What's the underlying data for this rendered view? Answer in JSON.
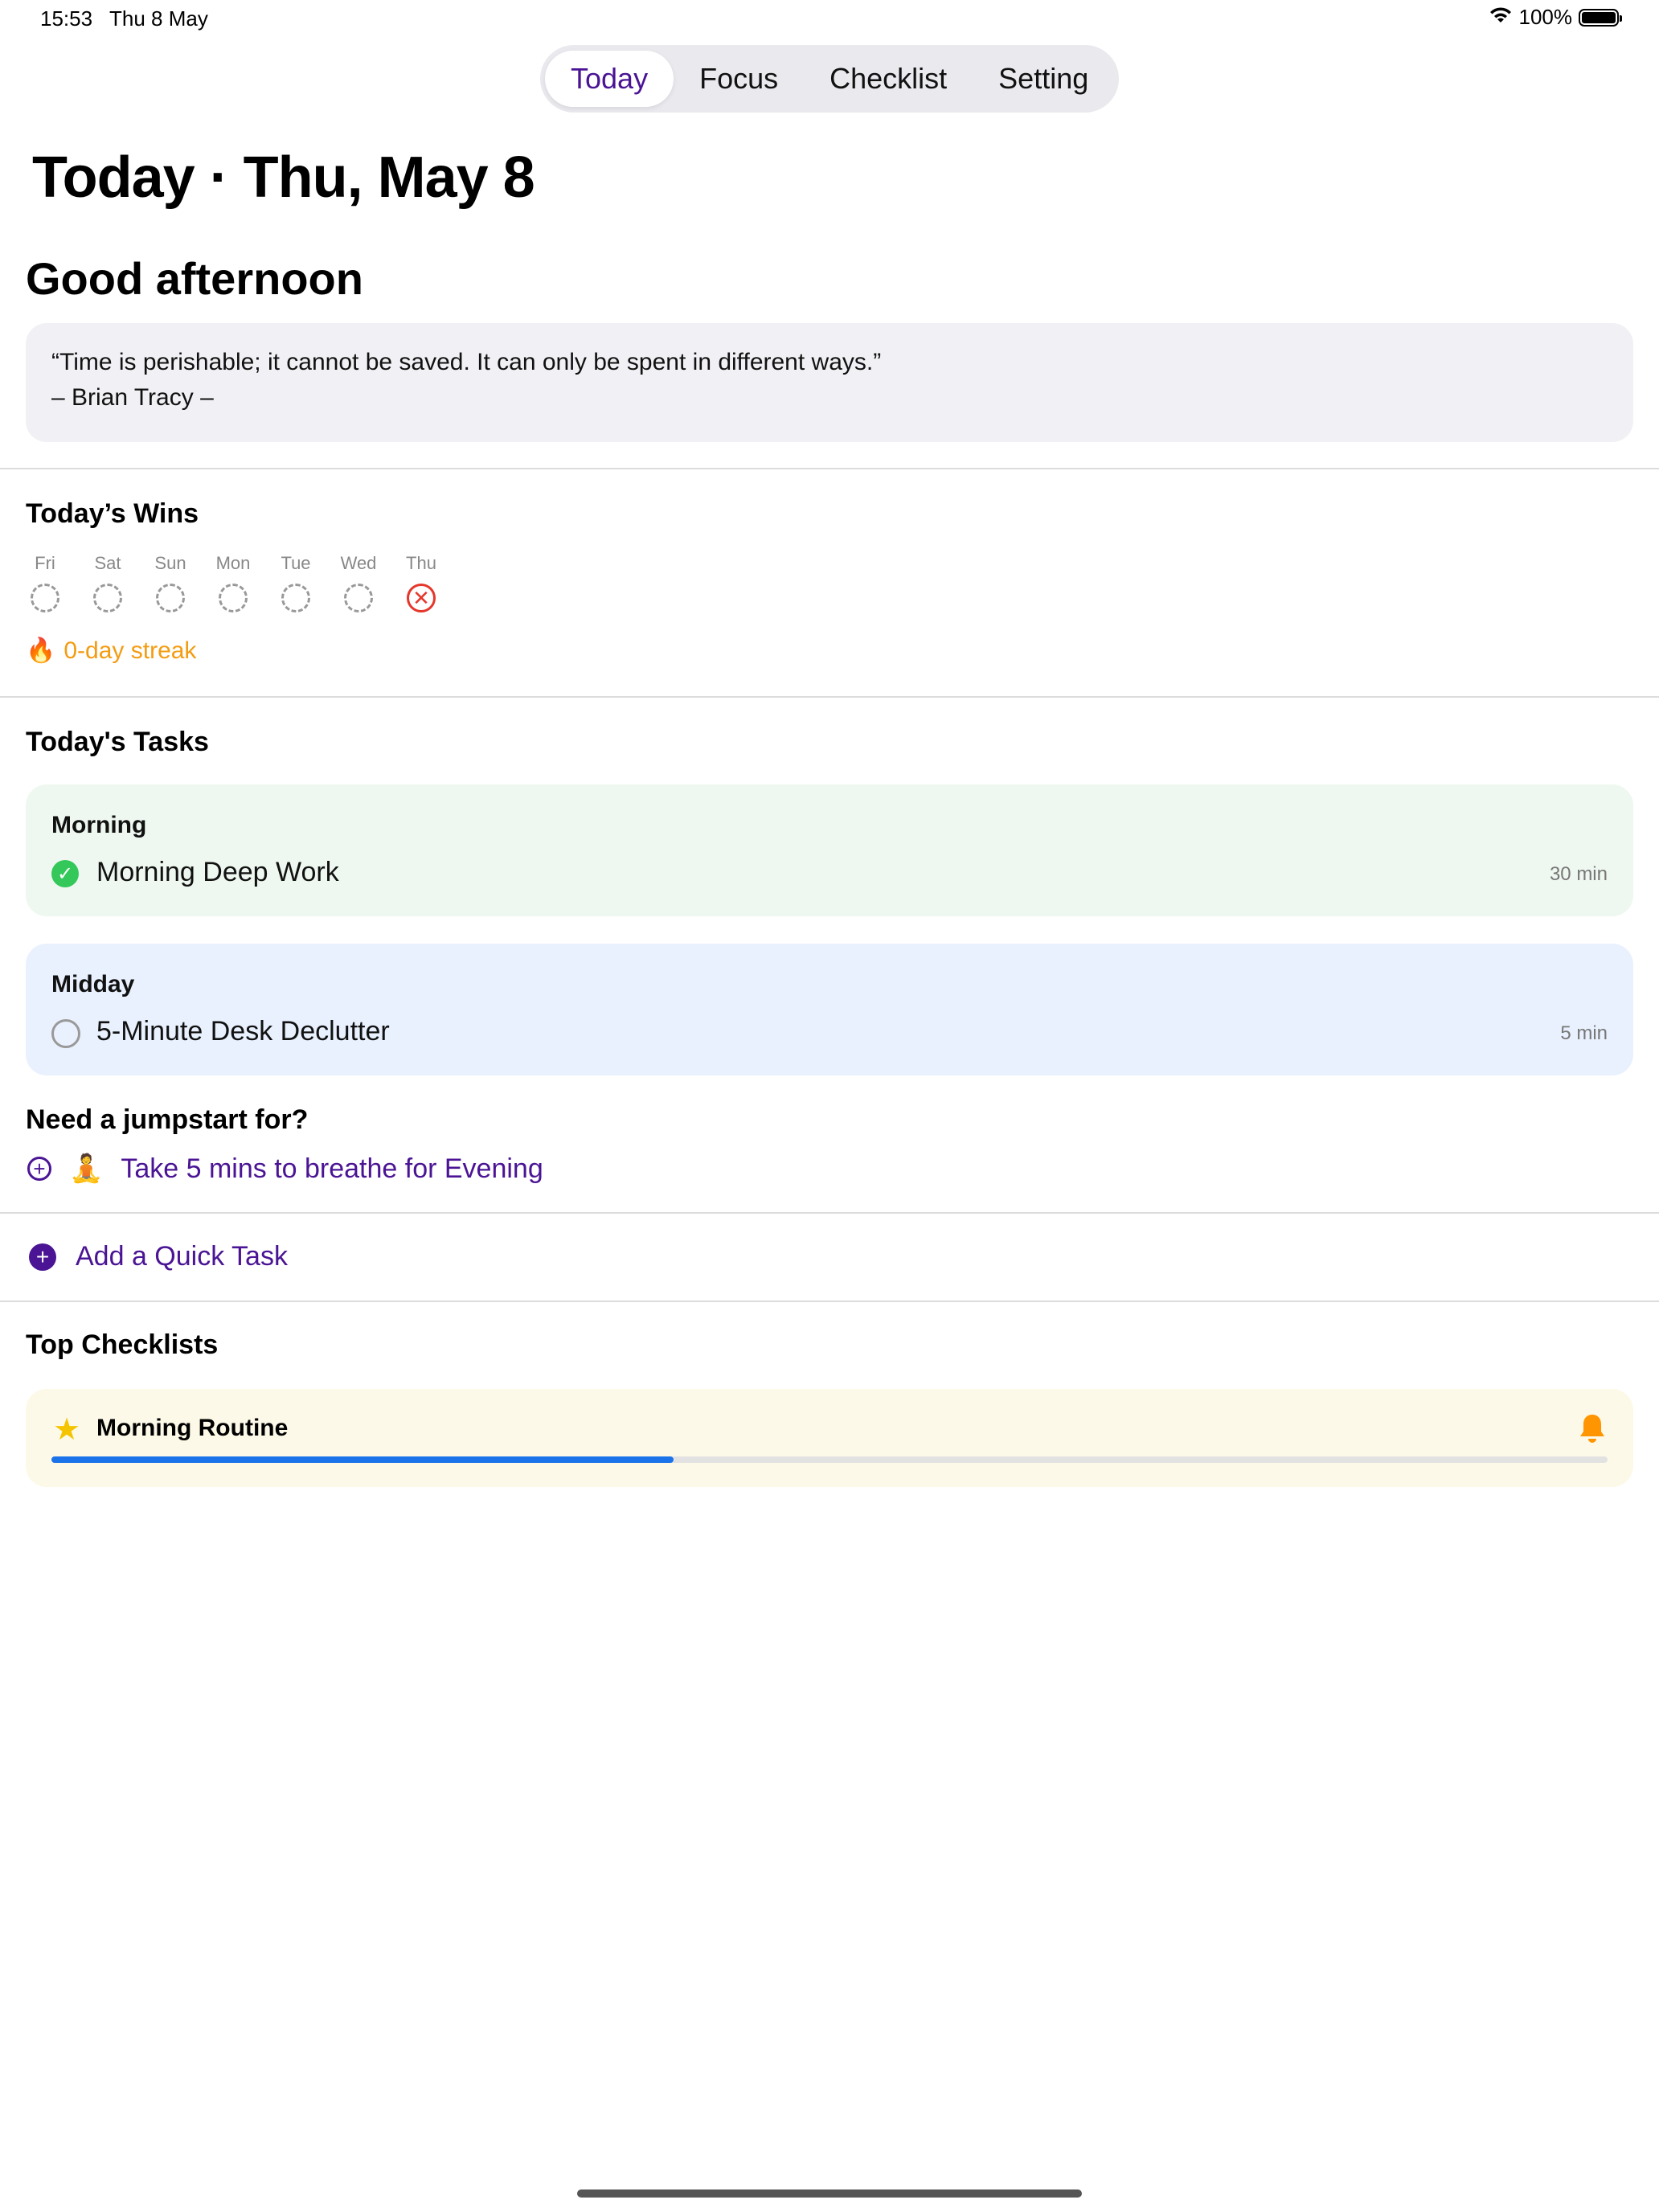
{
  "status_bar": {
    "time": "15:53",
    "date": "Thu 8 May",
    "battery": "100%"
  },
  "tabs": [
    {
      "label": "Today",
      "active": true
    },
    {
      "label": "Focus",
      "active": false
    },
    {
      "label": "Checklist",
      "active": false
    },
    {
      "label": "Setting",
      "active": false
    }
  ],
  "page_title": "Today · Thu, May 8",
  "greeting": "Good afternoon",
  "quote": {
    "text": "“Time is perishable; it cannot be saved. It can only be spent in different ways.”",
    "author": "– Brian Tracy –"
  },
  "wins": {
    "title": "Today’s Wins",
    "days": [
      {
        "label": "Fri",
        "state": "empty"
      },
      {
        "label": "Sat",
        "state": "empty"
      },
      {
        "label": "Sun",
        "state": "empty"
      },
      {
        "label": "Mon",
        "state": "empty"
      },
      {
        "label": "Tue",
        "state": "empty"
      },
      {
        "label": "Wed",
        "state": "empty"
      },
      {
        "label": "Thu",
        "state": "missed"
      }
    ],
    "streak_icon": "🔥",
    "streak": "0-day streak"
  },
  "tasks": {
    "title": "Today's Tasks",
    "groups": [
      {
        "name": "Morning",
        "color": "#eef8f0",
        "task": "Morning Deep Work",
        "duration": "30 min",
        "done": true
      },
      {
        "name": "Midday",
        "color": "#e9f1fe",
        "task": "5-Minute Desk Declutter",
        "duration": "5 min",
        "done": false
      }
    ]
  },
  "jumpstart": {
    "title": "Need a jumpstart for?",
    "emoji": "🧘",
    "suggestion": "Take 5 mins to breathe for Evening"
  },
  "quick_task": {
    "label": "Add a Quick Task"
  },
  "checklists": {
    "title": "Top Checklists",
    "items": [
      {
        "star": "★",
        "name": "Morning Routine",
        "progress": 0.4,
        "bell": "bell-icon",
        "card_color": "#fdf9e8"
      }
    ]
  },
  "colors": {
    "accent": "#4a1494",
    "done": "#34c759",
    "missed": "#e5372b",
    "streak": "#f39c12",
    "progress": "#1a73e8",
    "bell": "#ff9500"
  }
}
